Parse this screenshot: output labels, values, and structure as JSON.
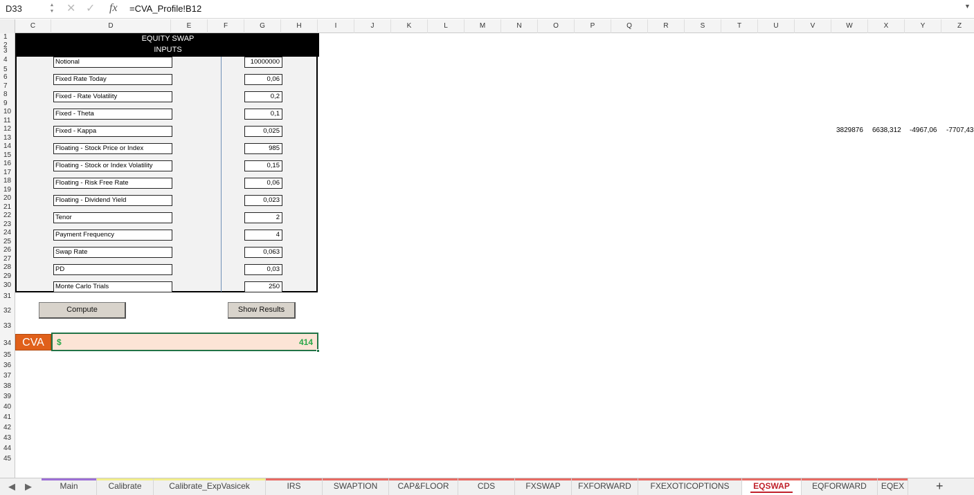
{
  "formula_bar": {
    "cell_ref": "D33",
    "fx": "fx",
    "formula": "=CVA_Profile!B12"
  },
  "columns": [
    "C",
    "D",
    "E",
    "F",
    "G",
    "H",
    "I",
    "J",
    "K",
    "L",
    "M",
    "N",
    "O",
    "P",
    "Q",
    "R",
    "S",
    "T",
    "U",
    "V",
    "W",
    "X",
    "Y",
    "Z"
  ],
  "rows": [
    "1",
    "2",
    "3",
    "4",
    "5",
    "6",
    "7",
    "8",
    "9",
    "10",
    "11",
    "12",
    "13",
    "14",
    "15",
    "16",
    "17",
    "18",
    "19",
    "20",
    "21",
    "22",
    "23",
    "24",
    "25",
    "26",
    "27",
    "28",
    "29",
    "30",
    "31",
    "32",
    "33",
    "34",
    "35",
    "36",
    "37",
    "38",
    "39",
    "40",
    "41",
    "42",
    "43",
    "44",
    "45"
  ],
  "inputs": {
    "title_line1": "EQUITY SWAP",
    "title_line2": "INPUTS",
    "params": [
      {
        "label": "Notional",
        "value": "10000000"
      },
      {
        "label": "Fixed Rate Today",
        "value": "0,06"
      },
      {
        "label": "Fixed - Rate Volatility",
        "value": "0,2"
      },
      {
        "label": "Fixed - Theta",
        "value": "0,1"
      },
      {
        "label": "Fixed - Kappa",
        "value": "0,025"
      },
      {
        "label": "Floating - Stock Price or Index",
        "value": "985"
      },
      {
        "label": "Floating - Stock or Index Volatility",
        "value": "0,15"
      },
      {
        "label": "Floating - Risk Free Rate",
        "value": "0,06"
      },
      {
        "label": "Floating - Dividend Yield",
        "value": "0,023"
      },
      {
        "label": "Tenor",
        "value": "2"
      },
      {
        "label": "Payment Frequency",
        "value": "4"
      },
      {
        "label": "Swap Rate",
        "value": "0,063"
      },
      {
        "label": "PD",
        "value": "0,03"
      },
      {
        "label": "Monte Carlo Trials",
        "value": "250"
      }
    ]
  },
  "buttons": {
    "compute": "Compute",
    "show_results": "Show Results"
  },
  "cva": {
    "label": "CVA",
    "currency": "$",
    "value": "414"
  },
  "row11_values": [
    "3829876",
    "6638,312",
    "-4967,06",
    "-7707,43"
  ],
  "tabs": [
    {
      "label": "Main",
      "color": "#9c6fd6"
    },
    {
      "label": "Calibrate",
      "color": "#f2ee8c"
    },
    {
      "label": "Calibrate_ExpVasicek",
      "color": "#f2ee8c"
    },
    {
      "label": "IRS",
      "color": "#e86a63"
    },
    {
      "label": "SWAPTION",
      "color": "#e86a63"
    },
    {
      "label": "CAP&FLOOR",
      "color": "#e86a63"
    },
    {
      "label": "CDS",
      "color": "#e86a63"
    },
    {
      "label": "FXSWAP",
      "color": "#e86a63"
    },
    {
      "label": "FXFORWARD",
      "color": "#e86a63"
    },
    {
      "label": "FXEXOTICOPTIONS",
      "color": "#e86a63"
    },
    {
      "label": "EQSWAP",
      "color": "#e86a63",
      "active": true
    },
    {
      "label": "EQFORWARD",
      "color": "#e86a63"
    },
    {
      "label": "EQEX",
      "color": "#e86a63"
    }
  ],
  "tab_add": "+"
}
